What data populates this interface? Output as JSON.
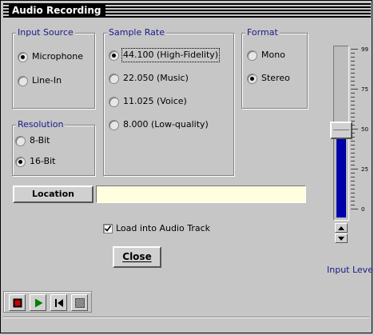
{
  "window": {
    "title": "Audio Recording"
  },
  "input_source": {
    "legend": "Input Source",
    "options": [
      {
        "label": "Microphone",
        "selected": true
      },
      {
        "label": "Line-In",
        "selected": false
      }
    ]
  },
  "sample_rate": {
    "legend": "Sample Rate",
    "options": [
      {
        "label": "44.100 (High-Fidelity)",
        "selected": true
      },
      {
        "label": "22.050 (Music)",
        "selected": false
      },
      {
        "label": "11.025 (Voice)",
        "selected": false
      },
      {
        "label": "8.000 (Low-quality)",
        "selected": false
      }
    ]
  },
  "format": {
    "legend": "Format",
    "options": [
      {
        "label": "Mono",
        "selected": false
      },
      {
        "label": "Stereo",
        "selected": true
      }
    ]
  },
  "resolution": {
    "legend": "Resolution",
    "options": [
      {
        "label": "8-Bit",
        "selected": false
      },
      {
        "label": "16-Bit",
        "selected": true
      }
    ]
  },
  "location": {
    "button_label": "Location",
    "value": ""
  },
  "load_into_track": {
    "label": "Load into Audio Track",
    "checked": true
  },
  "close_button": {
    "label": "Close"
  },
  "input_level": {
    "label": "Input Level",
    "level_percent": 50,
    "fill_color": "#0000a8",
    "scale_labels": [
      "99",
      "75",
      "50",
      "25",
      "0"
    ]
  },
  "transport": {
    "buttons": [
      {
        "icon": "record-icon",
        "color": "#cc0000"
      },
      {
        "icon": "play-icon",
        "color": "#008000"
      },
      {
        "icon": "rewind-to-start-icon",
        "color": "#000000"
      },
      {
        "icon": "stop-icon",
        "color": "#555555"
      }
    ]
  },
  "colors": {
    "legend_text": "#1a1a8c",
    "window_bg": "#c6c6c6",
    "field_bg": "#ffffe0"
  }
}
